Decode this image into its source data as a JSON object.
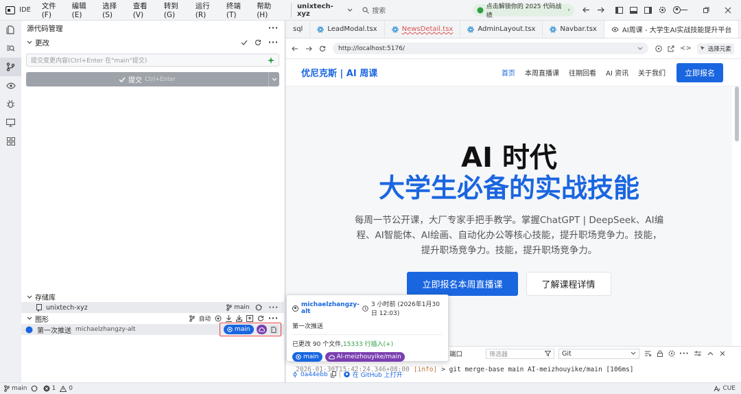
{
  "titlebar": {
    "ide_label": "IDE",
    "menus": [
      "文件(F)",
      "编辑(E)",
      "选择(S)",
      "查看(V)",
      "转到(G)",
      "运行(R)",
      "终端(T)",
      "帮助(H)"
    ],
    "workspace": "unixtech-xyz",
    "search_placeholder": "搜索",
    "banner": "点击解锁你的 2025 代码战绩"
  },
  "sidebar": {
    "title": "源代码管理",
    "changes_label": "更改",
    "commit_input_placeholder": "提交变更内容(Ctrl+Enter 在\"main\"提交)",
    "commit_button": "提交",
    "commit_shortcut": "Ctrl+Enter",
    "repos_label": "存储库",
    "repo_name": "unixtech-xyz",
    "repo_branch": "main",
    "graph_label": "图形",
    "graph_auto": "自动",
    "commit_message": "第一次推送",
    "commit_author": "michaelzhangzy-alt",
    "badge_branch": "main"
  },
  "tabs": [
    {
      "label": "sql",
      "color": "#333"
    },
    {
      "label": "LeadModal.tsx",
      "color": "#333"
    },
    {
      "label": "NewsDetail.tsx",
      "color": "#d9534f"
    },
    {
      "label": "AdminLayout.tsx",
      "color": "#333"
    },
    {
      "label": "Navbar.tsx",
      "color": "#333"
    },
    {
      "label": "AI周课 - 大学生AI实战技能提升平台",
      "color": "#333"
    }
  ],
  "browser": {
    "url": "http://localhost:5176/",
    "select_element": "选择元素"
  },
  "site": {
    "brand": "优尼克斯 | AI 周课",
    "nav": [
      "首页",
      "本周直播课",
      "往期回看",
      "AI 资讯",
      "关于我们"
    ],
    "cta": "立即报名",
    "hero_title": "AI 时代",
    "hero_subtitle": "大学生必备的实战技能",
    "hero_desc_1": "每周一节公开课，大厂专家手把手教学。掌握ChatGPT | DeepSeek、AI编",
    "hero_desc_2": "程、AI智能体、AI绘画、自动化办公等核心技能，提升职场竞争力。技能，",
    "hero_desc_3": "提升职场竞争力。技能，提升职场竞争力。",
    "btn_primary": "立即报名本周直播课",
    "btn_secondary": "了解课程详情"
  },
  "panel": {
    "tab_port": "端口",
    "filter_placeholder": "筛选器",
    "dropdown": "Git",
    "log_time": "2026-01-30T15:42:24.346+08:00",
    "log_level": "[info]",
    "log_text": "> git merge-base main AI-meizhouyike/main [106ms]"
  },
  "hover_card": {
    "author": "michaelzhangzy-alt",
    "time": "3 小时前 (2026年1月30日 12:03)",
    "message": "第一次推送",
    "stats_prefix": "已更改 90 个文件, ",
    "stats_insert": "15333 行插入(+)",
    "branch_local": "main",
    "branch_remote": "AI-meizhouyike/main",
    "hash": "0a44ebb",
    "github": "在 GitHub 上打开"
  },
  "status": {
    "branch": "main",
    "errors": "1",
    "warnings": "0",
    "right": "CUE"
  },
  "colors": {
    "accent": "#1a66e0",
    "purple": "#7a3fb0",
    "green": "#2f9e44",
    "highlight_red": "#e23b3b"
  }
}
